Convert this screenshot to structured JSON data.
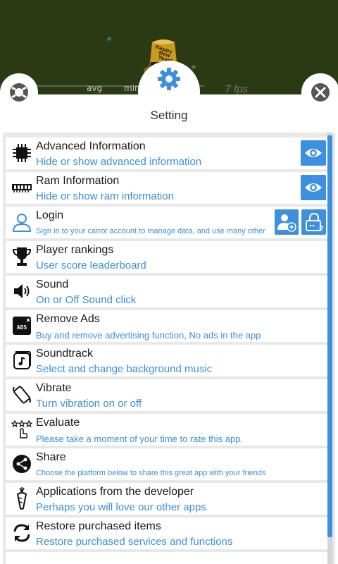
{
  "background": {
    "hat_text": "Happy New Year!",
    "stats": {
      "avg": "avg",
      "min": "min",
      "fps": "7 fps"
    }
  },
  "header": {
    "title": "Setting"
  },
  "colors": {
    "accent": "#3d8fe0",
    "subtitle": "#3a8fd8",
    "game_bg": "#2b3a13"
  },
  "settings": [
    {
      "title": "Advanced Information",
      "subtitle": "Hide or show advanced information",
      "icon": "chip-icon"
    },
    {
      "title": "Ram Information",
      "subtitle": "Hide or show ram information",
      "icon": "ram-icon"
    },
    {
      "title": "Login",
      "subtitle": "Sign in to your carrot account to manage data, and use many other",
      "icon": "user-icon"
    },
    {
      "title": "Player rankings",
      "subtitle": "User score leaderboard",
      "icon": "trophy-icon"
    },
    {
      "title": "Sound",
      "subtitle": "On or Off Sound click",
      "icon": "speaker-icon"
    },
    {
      "title": "Remove Ads",
      "subtitle": "Buy and remove advertising function, No ads in the app",
      "icon": "ads-icon"
    },
    {
      "title": "Soundtrack",
      "subtitle": "Select and change background music",
      "icon": "music-icon"
    },
    {
      "title": "Vibrate",
      "subtitle": "Turn vibration on or off",
      "icon": "vibrate-icon"
    },
    {
      "title": "Evaluate",
      "subtitle": "Please take a moment of your time to rate this app.",
      "icon": "rate-icon"
    },
    {
      "title": "Share",
      "subtitle": "Choose the platform below to share this great app with your friends",
      "icon": "share-icon"
    },
    {
      "title": "Applications from the developer",
      "subtitle": "Perhaps you will love our other apps",
      "icon": "carrot-icon"
    },
    {
      "title": "Restore purchased items",
      "subtitle": "Restore purchased services and functions",
      "icon": "restore-icon"
    }
  ]
}
